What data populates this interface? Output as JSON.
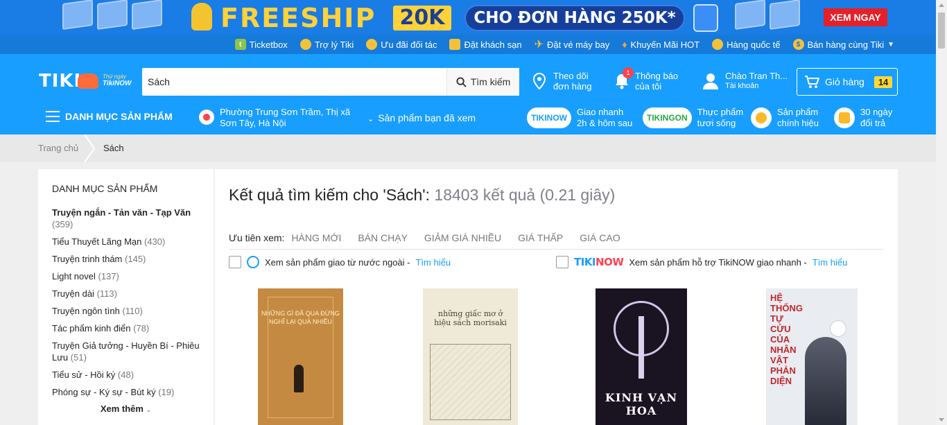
{
  "promo": {
    "headline": "FREESHIP",
    "amount": "20K",
    "condition": "CHO ĐƠN HÀNG 250K*",
    "cta": "XEM NGAY",
    "box_label": "TIKI"
  },
  "top_links": [
    {
      "label": "Ticketbox",
      "icon": "ticketbox-icon"
    },
    {
      "label": "Trợ lý Tiki",
      "icon": "assistant-icon"
    },
    {
      "label": "Ưu đãi đối tác",
      "icon": "partner-deal-icon"
    },
    {
      "label": "Đặt khách sạn",
      "icon": "hotel-icon"
    },
    {
      "label": "Đặt vé máy bay",
      "icon": "plane-icon"
    },
    {
      "label": "Khuyến Mãi HOT",
      "icon": "fire-icon"
    },
    {
      "label": "Hàng quốc tế",
      "icon": "globe-icon"
    },
    {
      "label": "Bán hàng cùng Tiki",
      "icon": "money-bag-icon"
    }
  ],
  "header": {
    "logo": "TIKI",
    "logo_tag_small": "Thứ ngày",
    "logo_tag": "TikiNOW",
    "search_value": "Sách",
    "search_button": "Tìm kiếm",
    "track_line1": "Theo dõi",
    "track_line2": "đơn hàng",
    "notif_line1": "Thông báo",
    "notif_line2": "của tôi",
    "notif_count": "1",
    "account_line1": "Chào Tran Th...",
    "account_line2": "Tài khoản",
    "cart_label": "Giỏ hàng",
    "cart_count": "14",
    "menu_label": "DANH MỤC SẢN PHẨM",
    "location": "Phường Trung Sơn Trầm, Thị xã Sơn Tây, Hà Nội",
    "viewed": "Sản phẩm bạn đã xem",
    "perks": [
      {
        "tag": "TIKINOW",
        "line1": "Giao nhanh",
        "line2": "2h & hôm sau"
      },
      {
        "tag": "TIKINGON",
        "line1": "Thực phẩm",
        "line2": "tươi sống"
      },
      {
        "tag": "",
        "line1": "Sản phẩm",
        "line2": "chính hiệu"
      },
      {
        "tag": "",
        "line1": "30 ngày",
        "line2": "đổi trả"
      }
    ]
  },
  "breadcrumb": [
    "Trang chủ",
    "Sách"
  ],
  "sidebar": {
    "title": "DANH MỤC SẢN PHẨM",
    "categories": [
      {
        "name": "Truyện ngắn - Tản văn - Tạp Văn",
        "count": "(359)"
      },
      {
        "name": "Tiểu Thuyết Lãng Mạn",
        "count": "(430)"
      },
      {
        "name": "Truyện trinh thám",
        "count": "(145)"
      },
      {
        "name": "Light novel",
        "count": "(137)"
      },
      {
        "name": "Truyện dài",
        "count": "(113)"
      },
      {
        "name": "Truyện ngôn tình",
        "count": "(110)"
      },
      {
        "name": "Tác phẩm kinh điển",
        "count": "(78)"
      },
      {
        "name": "Truyện Giả tưởng - Huyền Bí - Phiêu Lưu",
        "count": "(51)"
      },
      {
        "name": "Tiểu sử - Hồi ký",
        "count": "(48)"
      },
      {
        "name": "Phóng sự - Ký sự - Bút ký",
        "count": "(19)"
      }
    ],
    "more": "Xem thêm"
  },
  "main": {
    "result_prefix": "Kết quả tìm kiếm cho 'Sách':",
    "result_meta": "18403 kết quả (0.21 giây)",
    "sort_label": "Ưu tiên xem:",
    "sort_options": [
      "HÀNG MỚI",
      "BÁN CHẠY",
      "GIẢM GIÁ NHIỀU",
      "GIÁ THẤP",
      "GIÁ CAO"
    ],
    "filter_foreign": "Xem sản phẩm giao từ nước ngoài -",
    "filter_foreign_link": "Tìm hiểu",
    "filter_tikinow_logo_a": "TIKI",
    "filter_tikinow_logo_b": "NOW",
    "filter_tikinow": "Xem sản phẩm hỗ trợ TikiNOW giao nhanh -",
    "filter_tikinow_link": "Tìm hiểu",
    "products": [
      {
        "cover_text": "NHỮNG GÌ ĐÃ QUA ĐỪNG NGHĨ LẠI QUÁ NHIỀU"
      },
      {
        "cover_text": "những giấc mơ ở hiệu sách morisaki"
      },
      {
        "cover_text": "KINH VẠN HOA"
      },
      {
        "cover_text": "HỆ THỐNG TỰ CỨU CỦA NHÂN VẬT PHẢN DIỆN"
      }
    ]
  }
}
